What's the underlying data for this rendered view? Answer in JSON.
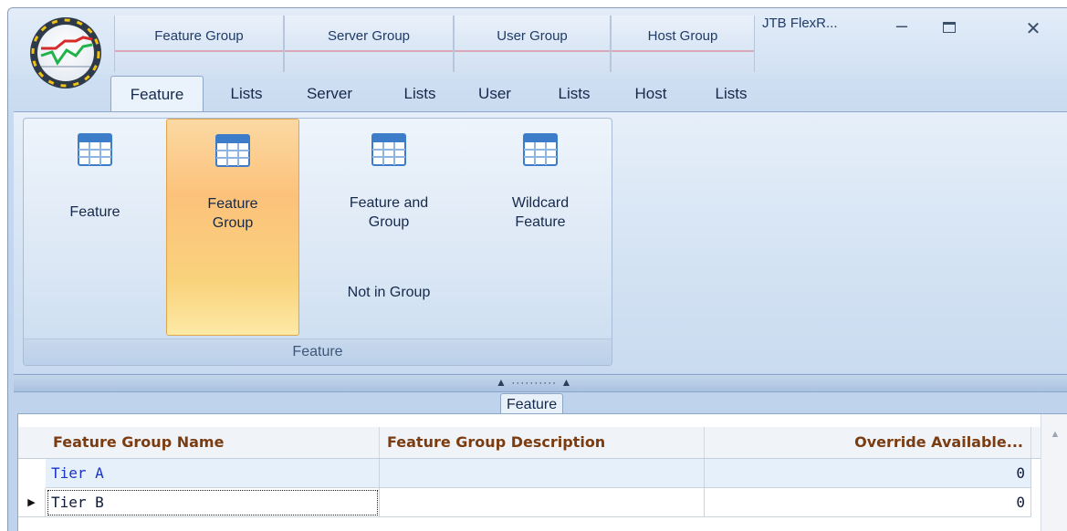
{
  "window": {
    "title": "JTB FlexR...",
    "colors": {
      "accent": "#fcc27b",
      "ribbon": "#d3e2f3",
      "header_text": "#7a3c10",
      "cell_text": "#1a33c8"
    }
  },
  "context_groups": [
    "Feature Group",
    "Server Group",
    "User Group",
    "Host Group"
  ],
  "tabs": [
    "Feature",
    "Lists",
    "Server",
    "Lists",
    "User",
    "Lists",
    "Host",
    "Lists"
  ],
  "active_tab": "Feature",
  "ribbon": {
    "group_caption": "Feature",
    "buttons": [
      {
        "label": "Feature",
        "icon": "table-icon"
      },
      {
        "label_line1": "Feature",
        "label_line2": "Group",
        "icon": "table-icon",
        "selected": true
      },
      {
        "label_line1": "Feature and",
        "label_line2": "Group",
        "label_extra": "Not in Group",
        "icon": "table-icon"
      },
      {
        "label_line1": "Wildcard",
        "label_line2": "Feature",
        "icon": "table-icon"
      }
    ]
  },
  "splitter": {
    "grip": "▲ ·········· ▲"
  },
  "panel": {
    "caption": "Feature"
  },
  "grid": {
    "columns": [
      "Feature Group Name",
      "Feature Group Description",
      "Override Available..."
    ],
    "rows": [
      {
        "name": "Tier A",
        "description": "",
        "override": "0",
        "selected": true
      },
      {
        "name": "Tier B",
        "description": "",
        "override": "0",
        "current": true
      }
    ]
  }
}
